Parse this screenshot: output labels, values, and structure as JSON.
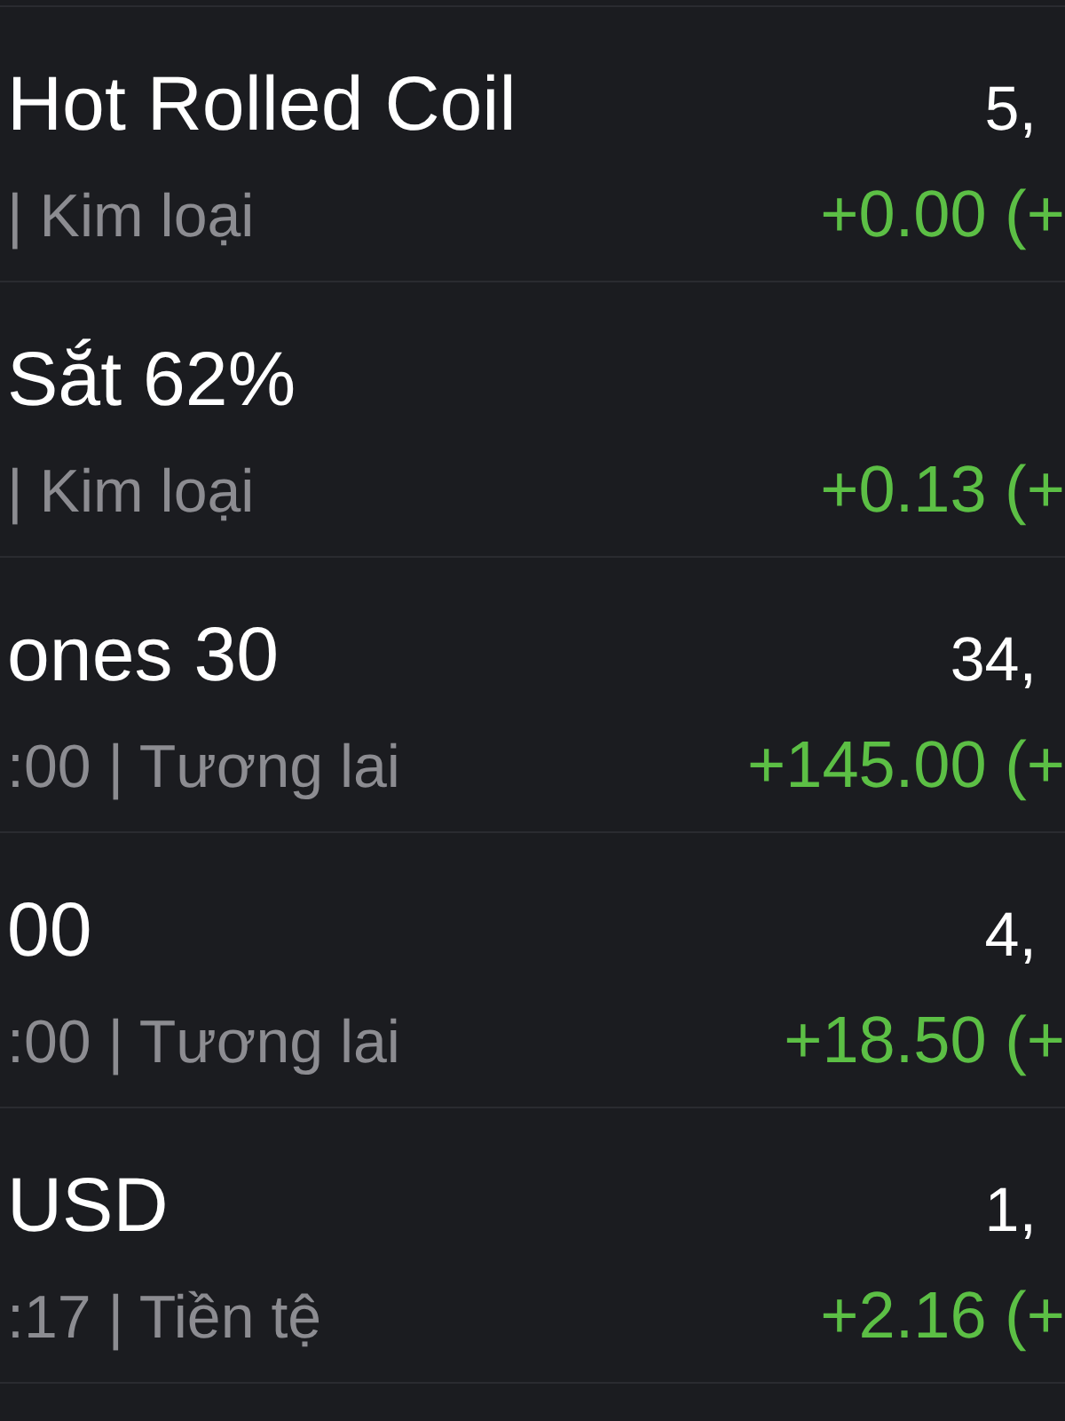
{
  "rows": [
    {
      "title": "Hot Rolled Coil",
      "subtitle": "| Kim loại",
      "price": "5,",
      "change": "+0.00 (+"
    },
    {
      "title": "Sắt 62%",
      "subtitle": "| Kim loại",
      "change": "+0.13 (+"
    },
    {
      "title": "ones 30",
      "subtitle": ":00 | Tương lai",
      "price": "34,",
      "change": "+145.00 (+"
    },
    {
      "title": "00",
      "subtitle": ":00 | Tương lai",
      "price": "4,",
      "change": "+18.50 (+"
    },
    {
      "title": "USD",
      "subtitle": ":17 | Tiền tệ",
      "price": "1,",
      "change": "+2.16 (+"
    }
  ]
}
